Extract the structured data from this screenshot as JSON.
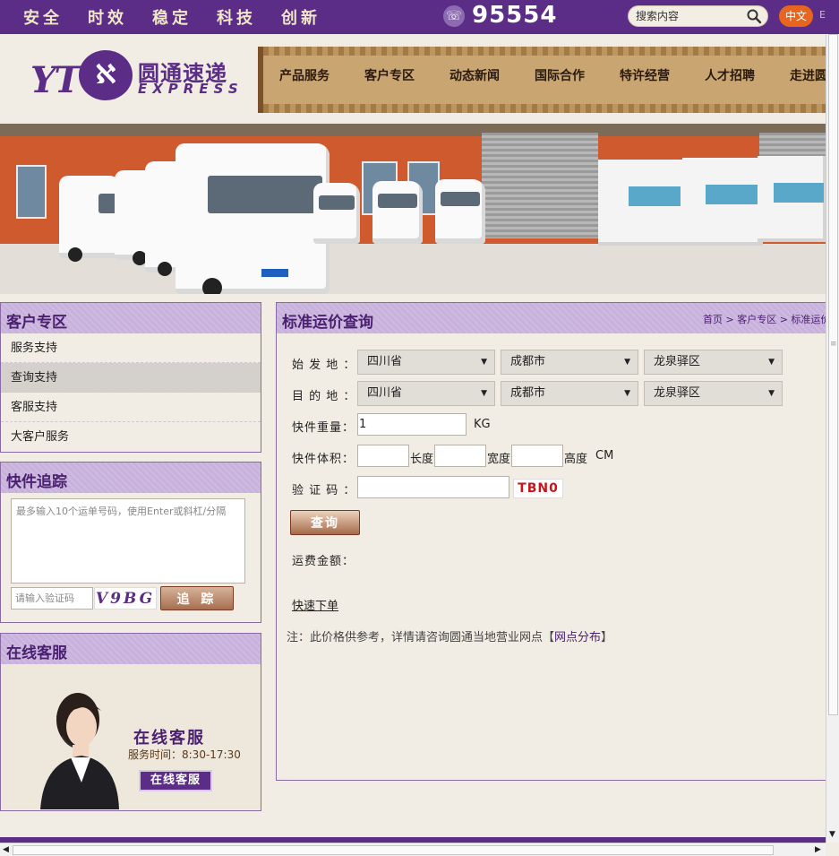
{
  "topbar": {
    "slogans": [
      "安全",
      "时效",
      "稳定",
      "科技",
      "创新"
    ],
    "phone_icon": "phone-icon",
    "phone": "95554",
    "search_placeholder": "搜索内容",
    "search_icon": "magnifier-icon",
    "lang_cn": "中文",
    "lang_en": "E"
  },
  "brand": {
    "logo_mark": "YT",
    "logo_cn": "圆通速递",
    "logo_en": "EXPRESS",
    "accent": "#5b2d87"
  },
  "nav": {
    "items": [
      "产品服务",
      "客户专区",
      "动态新闻",
      "国际合作",
      "特许经营",
      "人才招聘",
      "走进圆通"
    ]
  },
  "sidebar": {
    "customer_zone": {
      "title": "客户专区",
      "items": [
        {
          "label": "服务支持",
          "active": false
        },
        {
          "label": "查询支持",
          "active": true
        },
        {
          "label": "客服支持",
          "active": false
        },
        {
          "label": "大客户服务",
          "active": false
        }
      ]
    },
    "tracking": {
      "title": "快件追踪",
      "textarea_placeholder": "最多输入10个运单号码，使用Enter或斜杠/分隔",
      "code_placeholder": "请输入验证码",
      "captcha_text": "V9BG",
      "button_label": "追 踪"
    },
    "online_service": {
      "title": "在线客服",
      "service_title": "在线客服",
      "hours": "服务时间：8:30-17:30",
      "button_label": "在线客服"
    }
  },
  "main": {
    "title": "标准运价查询",
    "breadcrumb": "首页 > 客户专区 > 标准运价",
    "origin_label": "始 发 地 ：",
    "origin": {
      "province": "四川省",
      "city": "成都市",
      "district": "龙泉驿区"
    },
    "dest_label": "目 的 地 ：",
    "dest": {
      "province": "四川省",
      "city": "成都市",
      "district": "龙泉驿区"
    },
    "weight_label": "快件重量：",
    "weight_value": "1",
    "weight_unit": "KG",
    "volume_label": "快件体积：",
    "length_label": "长度",
    "width_label": "宽度",
    "height_label": "高度",
    "volume_unit": "CM",
    "captcha_label": "验 证 码 ：",
    "captcha_text": "TBN0",
    "query_button": "查询",
    "fee_label": "运费金额：",
    "quick_order": "快速下单",
    "note_prefix": "注：此价格供参考，详情请咨询圆通当地营业网点【",
    "note_link": "网点分布",
    "note_suffix": "】"
  }
}
